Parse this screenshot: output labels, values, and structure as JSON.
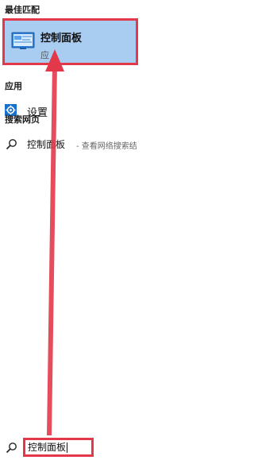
{
  "sections": {
    "best_match": "最佳匹配",
    "apps": "应用",
    "web": "搜索网页"
  },
  "best_match": {
    "title": "控制面板",
    "subtitle": "应",
    "icon": "control-panel-icon"
  },
  "apps": {
    "items": [
      {
        "label": "设置",
        "icon": "gear-icon"
      }
    ]
  },
  "web_result": {
    "query": "控制面板",
    "hint": "- 查看网络搜索结"
  },
  "search_box": {
    "value": "控制面板",
    "icon": "search-icon"
  },
  "colors": {
    "highlight": "#a9cdf0",
    "annotation_red": "#e2384a",
    "accent": "#1a6fc9"
  }
}
